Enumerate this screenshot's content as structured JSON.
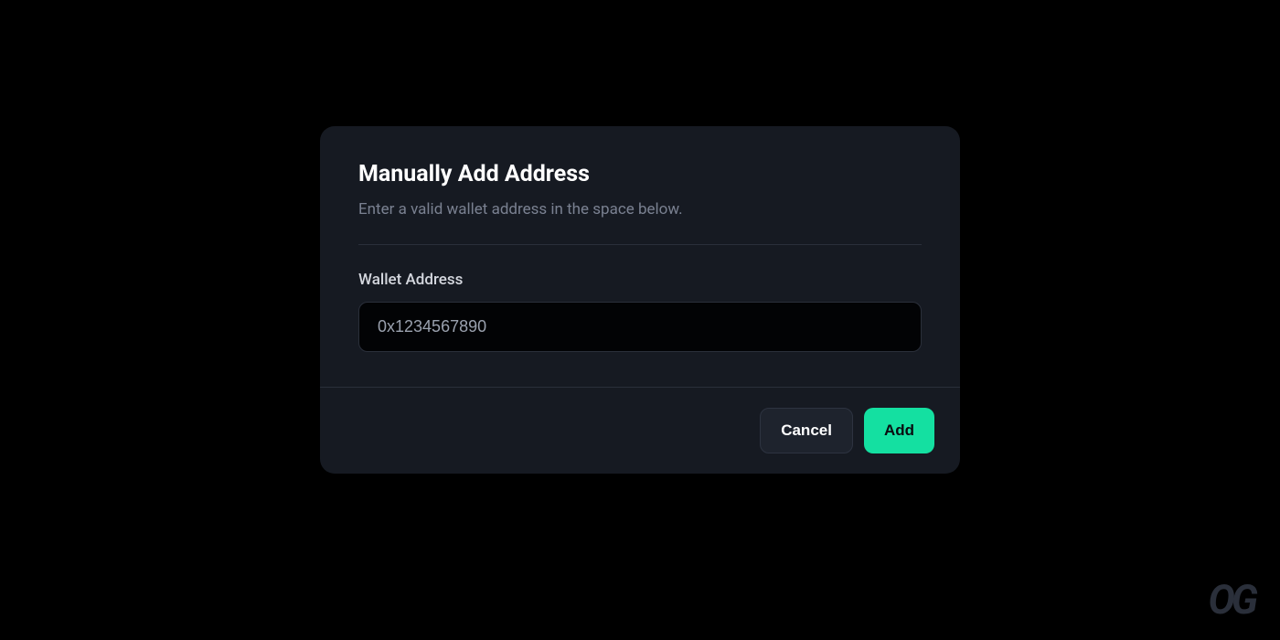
{
  "modal": {
    "title": "Manually Add Address",
    "subtitle": "Enter a valid wallet address in the space below.",
    "field_label": "Wallet Address",
    "input_value": "0x1234567890",
    "input_placeholder": "0x1234567890",
    "cancel_label": "Cancel",
    "add_label": "Add"
  },
  "brand": {
    "logo_text": "OG"
  },
  "colors": {
    "background": "#000000",
    "modal_bg": "#161a22",
    "accent": "#14e0a1",
    "text_primary": "#ffffff",
    "text_secondary": "#7a8191",
    "input_bg": "#020305",
    "border": "#2a2f3a"
  }
}
